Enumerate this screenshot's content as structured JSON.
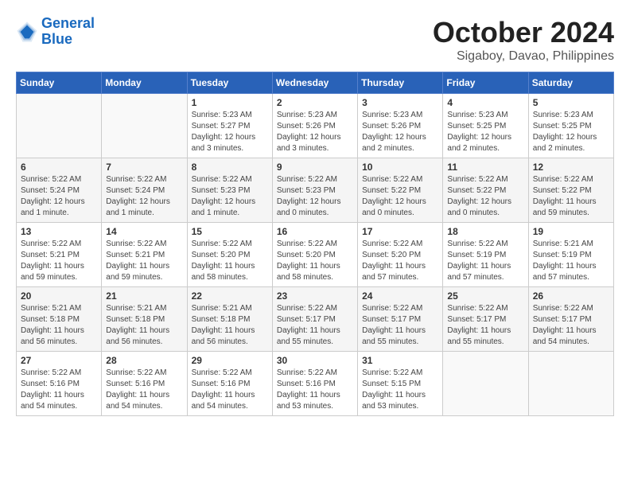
{
  "logo": {
    "line1": "General",
    "line2": "Blue"
  },
  "title": "October 2024",
  "location": "Sigaboy, Davao, Philippines",
  "weekdays": [
    "Sunday",
    "Monday",
    "Tuesday",
    "Wednesday",
    "Thursday",
    "Friday",
    "Saturday"
  ],
  "weeks": [
    [
      {
        "day": "",
        "content": ""
      },
      {
        "day": "",
        "content": ""
      },
      {
        "day": "1",
        "content": "Sunrise: 5:23 AM\nSunset: 5:27 PM\nDaylight: 12 hours and 3 minutes."
      },
      {
        "day": "2",
        "content": "Sunrise: 5:23 AM\nSunset: 5:26 PM\nDaylight: 12 hours and 3 minutes."
      },
      {
        "day": "3",
        "content": "Sunrise: 5:23 AM\nSunset: 5:26 PM\nDaylight: 12 hours and 2 minutes."
      },
      {
        "day": "4",
        "content": "Sunrise: 5:23 AM\nSunset: 5:25 PM\nDaylight: 12 hours and 2 minutes."
      },
      {
        "day": "5",
        "content": "Sunrise: 5:23 AM\nSunset: 5:25 PM\nDaylight: 12 hours and 2 minutes."
      }
    ],
    [
      {
        "day": "6",
        "content": "Sunrise: 5:22 AM\nSunset: 5:24 PM\nDaylight: 12 hours and 1 minute."
      },
      {
        "day": "7",
        "content": "Sunrise: 5:22 AM\nSunset: 5:24 PM\nDaylight: 12 hours and 1 minute."
      },
      {
        "day": "8",
        "content": "Sunrise: 5:22 AM\nSunset: 5:23 PM\nDaylight: 12 hours and 1 minute."
      },
      {
        "day": "9",
        "content": "Sunrise: 5:22 AM\nSunset: 5:23 PM\nDaylight: 12 hours and 0 minutes."
      },
      {
        "day": "10",
        "content": "Sunrise: 5:22 AM\nSunset: 5:22 PM\nDaylight: 12 hours and 0 minutes."
      },
      {
        "day": "11",
        "content": "Sunrise: 5:22 AM\nSunset: 5:22 PM\nDaylight: 12 hours and 0 minutes."
      },
      {
        "day": "12",
        "content": "Sunrise: 5:22 AM\nSunset: 5:22 PM\nDaylight: 11 hours and 59 minutes."
      }
    ],
    [
      {
        "day": "13",
        "content": "Sunrise: 5:22 AM\nSunset: 5:21 PM\nDaylight: 11 hours and 59 minutes."
      },
      {
        "day": "14",
        "content": "Sunrise: 5:22 AM\nSunset: 5:21 PM\nDaylight: 11 hours and 59 minutes."
      },
      {
        "day": "15",
        "content": "Sunrise: 5:22 AM\nSunset: 5:20 PM\nDaylight: 11 hours and 58 minutes."
      },
      {
        "day": "16",
        "content": "Sunrise: 5:22 AM\nSunset: 5:20 PM\nDaylight: 11 hours and 58 minutes."
      },
      {
        "day": "17",
        "content": "Sunrise: 5:22 AM\nSunset: 5:20 PM\nDaylight: 11 hours and 57 minutes."
      },
      {
        "day": "18",
        "content": "Sunrise: 5:22 AM\nSunset: 5:19 PM\nDaylight: 11 hours and 57 minutes."
      },
      {
        "day": "19",
        "content": "Sunrise: 5:21 AM\nSunset: 5:19 PM\nDaylight: 11 hours and 57 minutes."
      }
    ],
    [
      {
        "day": "20",
        "content": "Sunrise: 5:21 AM\nSunset: 5:18 PM\nDaylight: 11 hours and 56 minutes."
      },
      {
        "day": "21",
        "content": "Sunrise: 5:21 AM\nSunset: 5:18 PM\nDaylight: 11 hours and 56 minutes."
      },
      {
        "day": "22",
        "content": "Sunrise: 5:21 AM\nSunset: 5:18 PM\nDaylight: 11 hours and 56 minutes."
      },
      {
        "day": "23",
        "content": "Sunrise: 5:22 AM\nSunset: 5:17 PM\nDaylight: 11 hours and 55 minutes."
      },
      {
        "day": "24",
        "content": "Sunrise: 5:22 AM\nSunset: 5:17 PM\nDaylight: 11 hours and 55 minutes."
      },
      {
        "day": "25",
        "content": "Sunrise: 5:22 AM\nSunset: 5:17 PM\nDaylight: 11 hours and 55 minutes."
      },
      {
        "day": "26",
        "content": "Sunrise: 5:22 AM\nSunset: 5:17 PM\nDaylight: 11 hours and 54 minutes."
      }
    ],
    [
      {
        "day": "27",
        "content": "Sunrise: 5:22 AM\nSunset: 5:16 PM\nDaylight: 11 hours and 54 minutes."
      },
      {
        "day": "28",
        "content": "Sunrise: 5:22 AM\nSunset: 5:16 PM\nDaylight: 11 hours and 54 minutes."
      },
      {
        "day": "29",
        "content": "Sunrise: 5:22 AM\nSunset: 5:16 PM\nDaylight: 11 hours and 54 minutes."
      },
      {
        "day": "30",
        "content": "Sunrise: 5:22 AM\nSunset: 5:16 PM\nDaylight: 11 hours and 53 minutes."
      },
      {
        "day": "31",
        "content": "Sunrise: 5:22 AM\nSunset: 5:15 PM\nDaylight: 11 hours and 53 minutes."
      },
      {
        "day": "",
        "content": ""
      },
      {
        "day": "",
        "content": ""
      }
    ]
  ]
}
